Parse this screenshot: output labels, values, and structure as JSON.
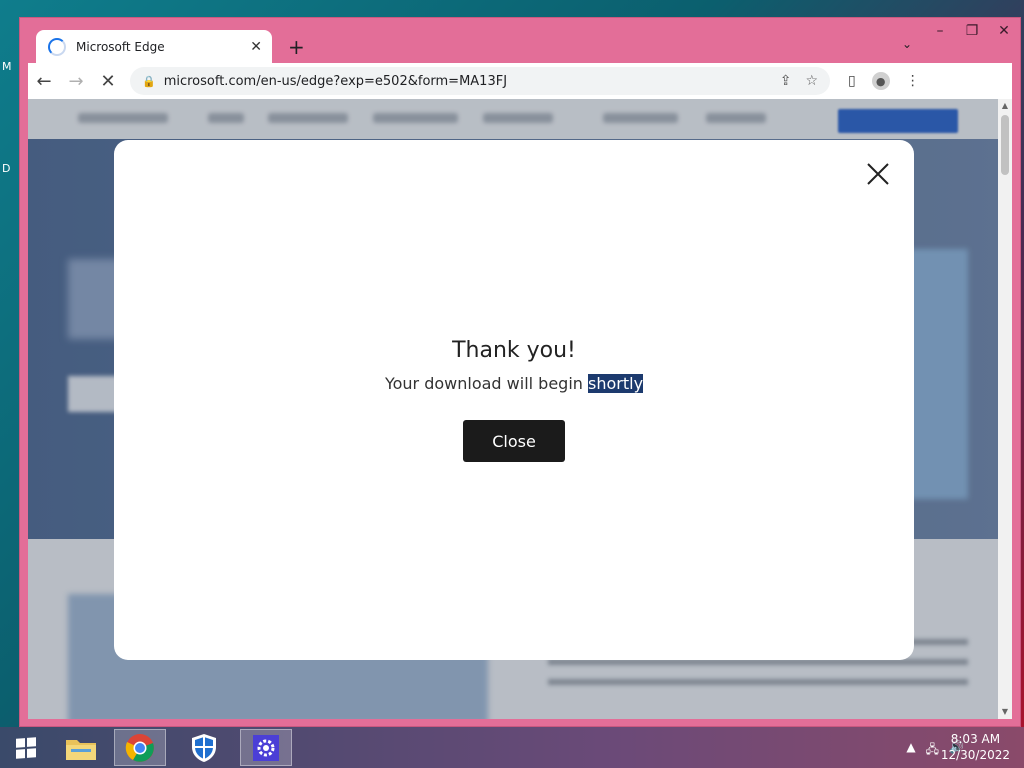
{
  "desktop": {
    "icon_labels": [
      "M",
      "D"
    ]
  },
  "browser": {
    "tab": {
      "title": "Microsoft Edge"
    },
    "address": {
      "url": "microsoft.com/en-us/edge?exp=e502&form=MA13FJ"
    },
    "window_controls": {
      "minimize": "–",
      "maximize": "❐",
      "close": "✕"
    }
  },
  "dialog": {
    "title": "Thank you!",
    "message_prefix": "Your download will begin ",
    "message_highlight": "shortly",
    "close_button": "Close"
  },
  "taskbar": {
    "apps": [
      "file-explorer",
      "chrome",
      "windows-defender",
      "settings"
    ],
    "time": "8:03 AM",
    "date": "12/30/2022"
  },
  "colors": {
    "window_frame": "#e36e98",
    "modal_button": "#1b1b1b",
    "selection_highlight": "#1c3a6e"
  }
}
